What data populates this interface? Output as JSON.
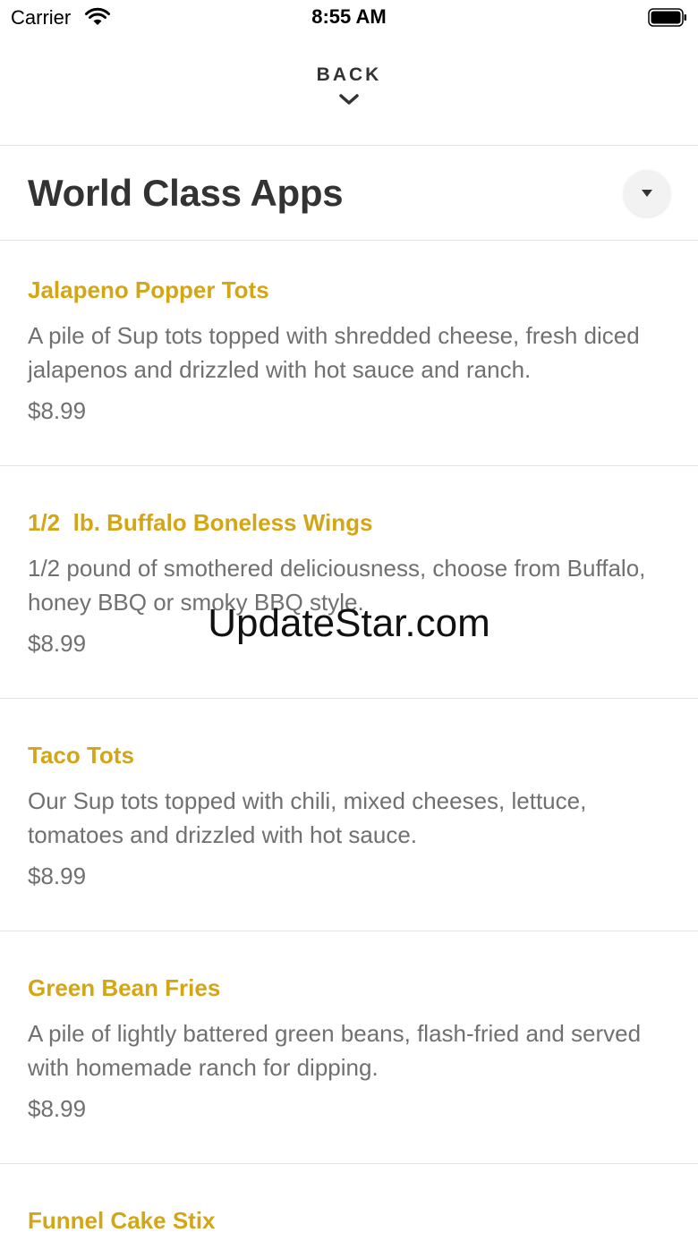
{
  "status_bar": {
    "carrier": "Carrier",
    "time": "8:55 AM"
  },
  "nav": {
    "back_label": "BACK"
  },
  "section": {
    "title": "World Class Apps"
  },
  "items": [
    {
      "name": "Jalapeno Popper Tots",
      "description": "A pile of Sup tots topped with shredded cheese, fresh diced jalapenos and drizzled with hot sauce and ranch.",
      "price": "$8.99"
    },
    {
      "name": "1/2  lb. Buffalo Boneless Wings",
      "description": "1/2 pound of smothered deliciousness, choose from Buffalo, honey BBQ or smoky BBQ style.",
      "price": "$8.99"
    },
    {
      "name": "Taco Tots",
      "description": "Our Sup tots topped with chili, mixed cheeses, lettuce, tomatoes and drizzled with hot sauce.",
      "price": "$8.99"
    },
    {
      "name": "Green Bean Fries",
      "description": "A pile of lightly battered green beans, flash-fried and served with homemade ranch for dipping.",
      "price": "$8.99"
    },
    {
      "name": "Funnel Cake Stix"
    }
  ],
  "watermark": "UpdateStar.com",
  "colors": {
    "item_name": "#d4a514",
    "body_text": "#707070",
    "title": "#333333",
    "divider": "#e3e3e3"
  }
}
